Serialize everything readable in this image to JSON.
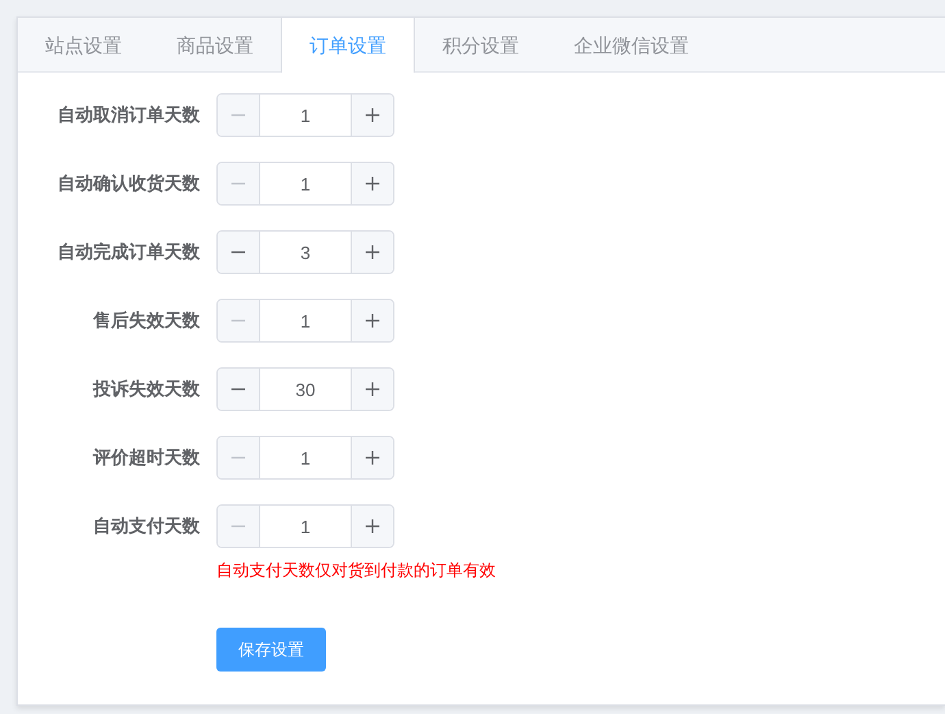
{
  "tabs": [
    {
      "label": "站点设置",
      "selected": false
    },
    {
      "label": "商品设置",
      "selected": false
    },
    {
      "label": "订单设置",
      "selected": true
    },
    {
      "label": "积分设置",
      "selected": false
    },
    {
      "label": "企业微信设置",
      "selected": false
    }
  ],
  "fields": [
    {
      "label": "自动取消订单天数",
      "value": "1",
      "minus_disabled": true
    },
    {
      "label": "自动确认收货天数",
      "value": "1",
      "minus_disabled": true
    },
    {
      "label": "自动完成订单天数",
      "value": "3",
      "minus_disabled": false
    },
    {
      "label": "售后失效天数",
      "value": "1",
      "minus_disabled": true
    },
    {
      "label": "投诉失效天数",
      "value": "30",
      "minus_disabled": false
    },
    {
      "label": "评价超时天数",
      "value": "1",
      "minus_disabled": true
    },
    {
      "label": "自动支付天数",
      "value": "1",
      "minus_disabled": true,
      "note": "自动支付天数仅对货到付款的订单有效"
    }
  ],
  "save_button": "保存设置"
}
